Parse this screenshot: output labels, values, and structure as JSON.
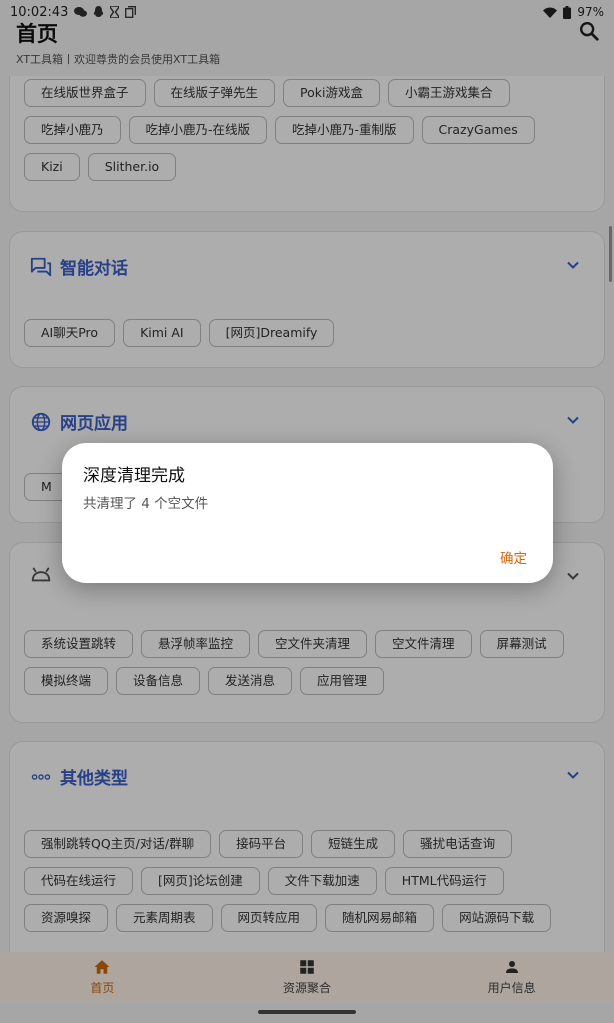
{
  "status_bar": {
    "time": "10:02:43",
    "battery": "97%"
  },
  "app_bar": {
    "title": "首页",
    "subtitle": "XT工具箱丨欢迎尊贵的会员使用XT工具箱"
  },
  "sections": {
    "games": {
      "partial_items": [
        "在线版世界盒子",
        "在线版子弹先生",
        "Poki游戏盒",
        "小霸王游戏集合"
      ],
      "items": [
        "吃掉小鹿乃",
        "吃掉小鹿乃-在线版",
        "吃掉小鹿乃-重制版",
        "CrazyGames",
        "Kizi",
        "Slither.io"
      ]
    },
    "chat": {
      "title": "智能对话",
      "items": [
        "AI聊天Pro",
        "Kimi AI",
        "[网页]Dreamify"
      ]
    },
    "web_apps": {
      "title": "网页应用",
      "items": [
        "M"
      ]
    },
    "system": {
      "items": [
        "系统设置跳转",
        "悬浮帧率监控",
        "空文件夹清理",
        "空文件清理",
        "屏幕测试",
        "模拟终端",
        "设备信息",
        "发送消息",
        "应用管理"
      ]
    },
    "other": {
      "title": "其他类型",
      "items": [
        "强制跳转QQ主页/对话/群聊",
        "接码平台",
        "短链生成",
        "骚扰电话查询",
        "代码在线运行",
        "[网页]论坛创建",
        "文件下载加速",
        "HTML代码运行",
        "资源嗅探",
        "元素周期表",
        "网页转应用",
        "随机网易邮箱",
        "网站源码下载"
      ]
    }
  },
  "bottom_nav": [
    {
      "label": "首页",
      "icon": "home-icon",
      "active": true
    },
    {
      "label": "资源聚合",
      "icon": "grid-icon",
      "active": false
    },
    {
      "label": "用户信息",
      "icon": "person-icon",
      "active": false
    }
  ],
  "dialog": {
    "title": "深度清理完成",
    "message": "共清理了 4 个空文件",
    "confirm": "确定"
  },
  "colors": {
    "accent": "#d0680e",
    "section_title": "#3a5fc8",
    "nav_bg": "#fff4e9"
  }
}
